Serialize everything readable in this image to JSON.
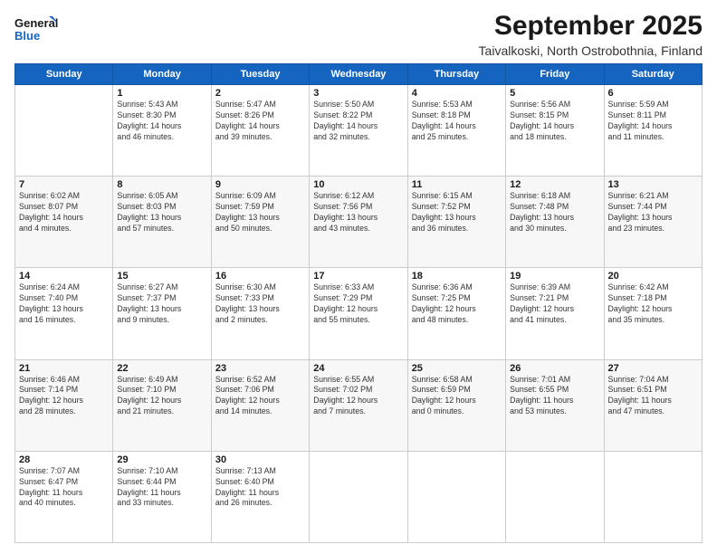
{
  "logo": {
    "line1": "General",
    "line2": "Blue"
  },
  "title": "September 2025",
  "subtitle": "Taivalkoski, North Ostrobothnia, Finland",
  "weekdays": [
    "Sunday",
    "Monday",
    "Tuesday",
    "Wednesday",
    "Thursday",
    "Friday",
    "Saturday"
  ],
  "weeks": [
    [
      {
        "day": "",
        "info": ""
      },
      {
        "day": "1",
        "info": "Sunrise: 5:43 AM\nSunset: 8:30 PM\nDaylight: 14 hours\nand 46 minutes."
      },
      {
        "day": "2",
        "info": "Sunrise: 5:47 AM\nSunset: 8:26 PM\nDaylight: 14 hours\nand 39 minutes."
      },
      {
        "day": "3",
        "info": "Sunrise: 5:50 AM\nSunset: 8:22 PM\nDaylight: 14 hours\nand 32 minutes."
      },
      {
        "day": "4",
        "info": "Sunrise: 5:53 AM\nSunset: 8:18 PM\nDaylight: 14 hours\nand 25 minutes."
      },
      {
        "day": "5",
        "info": "Sunrise: 5:56 AM\nSunset: 8:15 PM\nDaylight: 14 hours\nand 18 minutes."
      },
      {
        "day": "6",
        "info": "Sunrise: 5:59 AM\nSunset: 8:11 PM\nDaylight: 14 hours\nand 11 minutes."
      }
    ],
    [
      {
        "day": "7",
        "info": "Sunrise: 6:02 AM\nSunset: 8:07 PM\nDaylight: 14 hours\nand 4 minutes."
      },
      {
        "day": "8",
        "info": "Sunrise: 6:05 AM\nSunset: 8:03 PM\nDaylight: 13 hours\nand 57 minutes."
      },
      {
        "day": "9",
        "info": "Sunrise: 6:09 AM\nSunset: 7:59 PM\nDaylight: 13 hours\nand 50 minutes."
      },
      {
        "day": "10",
        "info": "Sunrise: 6:12 AM\nSunset: 7:56 PM\nDaylight: 13 hours\nand 43 minutes."
      },
      {
        "day": "11",
        "info": "Sunrise: 6:15 AM\nSunset: 7:52 PM\nDaylight: 13 hours\nand 36 minutes."
      },
      {
        "day": "12",
        "info": "Sunrise: 6:18 AM\nSunset: 7:48 PM\nDaylight: 13 hours\nand 30 minutes."
      },
      {
        "day": "13",
        "info": "Sunrise: 6:21 AM\nSunset: 7:44 PM\nDaylight: 13 hours\nand 23 minutes."
      }
    ],
    [
      {
        "day": "14",
        "info": "Sunrise: 6:24 AM\nSunset: 7:40 PM\nDaylight: 13 hours\nand 16 minutes."
      },
      {
        "day": "15",
        "info": "Sunrise: 6:27 AM\nSunset: 7:37 PM\nDaylight: 13 hours\nand 9 minutes."
      },
      {
        "day": "16",
        "info": "Sunrise: 6:30 AM\nSunset: 7:33 PM\nDaylight: 13 hours\nand 2 minutes."
      },
      {
        "day": "17",
        "info": "Sunrise: 6:33 AM\nSunset: 7:29 PM\nDaylight: 12 hours\nand 55 minutes."
      },
      {
        "day": "18",
        "info": "Sunrise: 6:36 AM\nSunset: 7:25 PM\nDaylight: 12 hours\nand 48 minutes."
      },
      {
        "day": "19",
        "info": "Sunrise: 6:39 AM\nSunset: 7:21 PM\nDaylight: 12 hours\nand 41 minutes."
      },
      {
        "day": "20",
        "info": "Sunrise: 6:42 AM\nSunset: 7:18 PM\nDaylight: 12 hours\nand 35 minutes."
      }
    ],
    [
      {
        "day": "21",
        "info": "Sunrise: 6:46 AM\nSunset: 7:14 PM\nDaylight: 12 hours\nand 28 minutes."
      },
      {
        "day": "22",
        "info": "Sunrise: 6:49 AM\nSunset: 7:10 PM\nDaylight: 12 hours\nand 21 minutes."
      },
      {
        "day": "23",
        "info": "Sunrise: 6:52 AM\nSunset: 7:06 PM\nDaylight: 12 hours\nand 14 minutes."
      },
      {
        "day": "24",
        "info": "Sunrise: 6:55 AM\nSunset: 7:02 PM\nDaylight: 12 hours\nand 7 minutes."
      },
      {
        "day": "25",
        "info": "Sunrise: 6:58 AM\nSunset: 6:59 PM\nDaylight: 12 hours\nand 0 minutes."
      },
      {
        "day": "26",
        "info": "Sunrise: 7:01 AM\nSunset: 6:55 PM\nDaylight: 11 hours\nand 53 minutes."
      },
      {
        "day": "27",
        "info": "Sunrise: 7:04 AM\nSunset: 6:51 PM\nDaylight: 11 hours\nand 47 minutes."
      }
    ],
    [
      {
        "day": "28",
        "info": "Sunrise: 7:07 AM\nSunset: 6:47 PM\nDaylight: 11 hours\nand 40 minutes."
      },
      {
        "day": "29",
        "info": "Sunrise: 7:10 AM\nSunset: 6:44 PM\nDaylight: 11 hours\nand 33 minutes."
      },
      {
        "day": "30",
        "info": "Sunrise: 7:13 AM\nSunset: 6:40 PM\nDaylight: 11 hours\nand 26 minutes."
      },
      {
        "day": "",
        "info": ""
      },
      {
        "day": "",
        "info": ""
      },
      {
        "day": "",
        "info": ""
      },
      {
        "day": "",
        "info": ""
      }
    ]
  ]
}
